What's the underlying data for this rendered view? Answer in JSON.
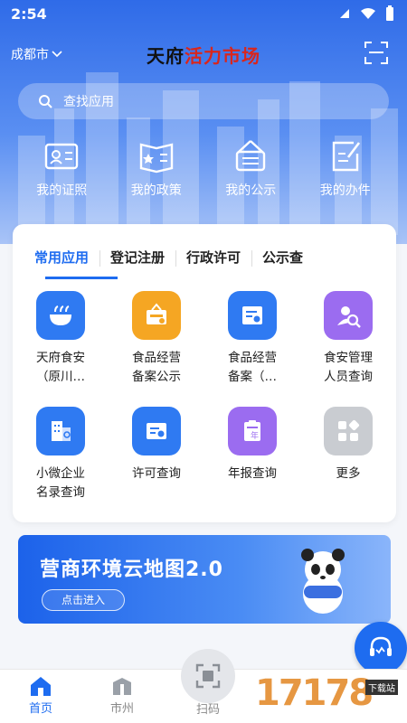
{
  "status": {
    "time": "2:54"
  },
  "header": {
    "city": "成都市",
    "title_black": "天府",
    "title_red": "活力市场"
  },
  "search": {
    "placeholder": "查找应用"
  },
  "quick": [
    {
      "label": "我的证照",
      "icon": "id-card-icon"
    },
    {
      "label": "我的政策",
      "icon": "policy-book-icon"
    },
    {
      "label": "我的公示",
      "icon": "notice-board-icon"
    },
    {
      "label": "我的办件",
      "icon": "task-edit-icon"
    }
  ],
  "tabs": [
    "常用应用",
    "登记注册",
    "行政许可",
    "公示查"
  ],
  "apps": [
    {
      "line1": "天府食安",
      "line2": "（原川…",
      "icon": "food-bowl-icon",
      "color": "#2f7af2"
    },
    {
      "line1": "食品经营",
      "line2": "备案公示",
      "icon": "certificate-sign-icon",
      "color": "#f5a623"
    },
    {
      "line1": "食品经营",
      "line2": "备案（…",
      "icon": "document-seal-icon",
      "color": "#2f7af2"
    },
    {
      "line1": "食安管理",
      "line2": "人员查询",
      "icon": "user-search-icon",
      "color": "#9b6cf0"
    },
    {
      "line1": "小微企业",
      "line2": "名录查询",
      "icon": "building-search-icon",
      "color": "#2f7af2"
    },
    {
      "line1": "许可查询",
      "line2": "",
      "icon": "license-icon",
      "color": "#2f7af2"
    },
    {
      "line1": "年报查询",
      "line2": "",
      "icon": "annual-report-icon",
      "color": "#9b6cf0"
    },
    {
      "line1": "更多",
      "line2": "",
      "icon": "more-grid-icon",
      "color": "#c9ccd1"
    }
  ],
  "annual_glyph": "年",
  "banner": {
    "title": "营商环境云地图2.0",
    "button": "点击进入"
  },
  "tabbar": [
    {
      "label": "首页",
      "icon": "home-icon"
    },
    {
      "label": "市州",
      "icon": "region-icon"
    },
    {
      "label": "扫码",
      "icon": "scan-icon"
    }
  ],
  "watermark": {
    "text": "17178",
    "tag": "下载站"
  },
  "colors": {
    "primary": "#1e6cf0",
    "hero_top": "#2f6be8",
    "accent_red": "#d9261c"
  }
}
